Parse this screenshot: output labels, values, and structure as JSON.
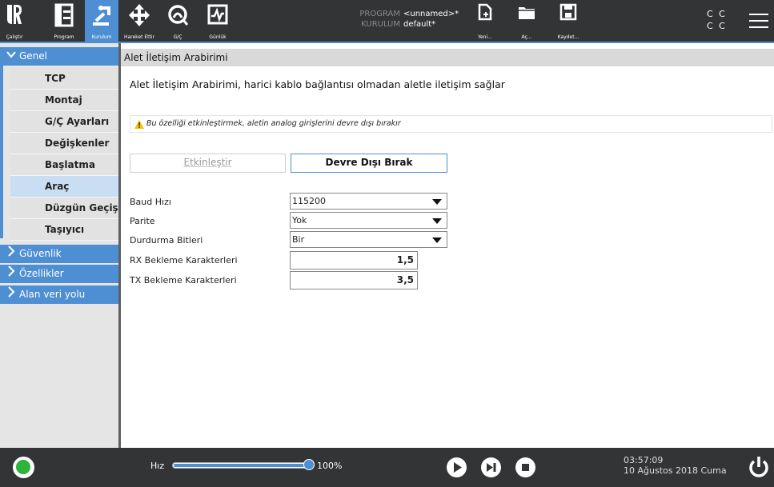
{
  "topbar": {
    "nav": [
      {
        "id": "calistir",
        "label": "Çalıştır",
        "icon": "ur-logo-icon"
      },
      {
        "id": "program",
        "label": "Program",
        "icon": "program-tree-icon"
      },
      {
        "id": "kurulum",
        "label": "Kurulum",
        "icon": "installation-robot-icon"
      },
      {
        "id": "hareket",
        "label": "Hareket Ettir",
        "icon": "move-arrows-icon"
      },
      {
        "id": "gc",
        "label": "G/Ç",
        "icon": "io-gauge-icon"
      },
      {
        "id": "gunluk",
        "label": "Günlük",
        "icon": "log-chart-icon"
      }
    ],
    "program_key": "PROGRAM",
    "program_value": "<unnamed>*",
    "installation_key": "KURULUM",
    "installation_value": "default*",
    "file_buttons": [
      {
        "id": "yeni",
        "label": "Yeni...",
        "icon": "new-file-icon"
      },
      {
        "id": "ac",
        "label": "Aç...",
        "icon": "open-folder-icon"
      },
      {
        "id": "kaydet",
        "label": "Kaydet...",
        "icon": "save-disk-icon"
      }
    ],
    "cc_line1": "C C",
    "cc_line2": "C C"
  },
  "sidebar": {
    "sections": [
      {
        "label": "Genel",
        "expanded": true
      },
      {
        "label": "Güvenlik",
        "expanded": false
      },
      {
        "label": "Özellikler",
        "expanded": false
      },
      {
        "label": "Alan veri yolu",
        "expanded": false
      }
    ],
    "items": [
      {
        "label": "TCP",
        "active": false
      },
      {
        "label": "Montaj",
        "active": false
      },
      {
        "label": "G/Ç Ayarları",
        "active": false
      },
      {
        "label": "Değişkenler",
        "active": false
      },
      {
        "label": "Başlatma",
        "active": false
      },
      {
        "label": "Araç",
        "active": true
      },
      {
        "label": "Düzgün Geçiş",
        "active": false
      },
      {
        "label": "Taşıyıcı Takibi",
        "active": false
      }
    ]
  },
  "main": {
    "header": "Alet İletişim Arabirimi",
    "description": "Alet İletişim Arabirimi, harici kablo bağlantısı olmadan aletle iletişim sağlar",
    "warning": "Bu özelliği etkinleştirmek, aletin analog girişlerini devre dışı bırakır",
    "enable_label": "Etkinleştir",
    "disable_label": "Devre Dışı Bırak",
    "fields": {
      "baud_label": "Baud Hızı",
      "baud_value": "115200",
      "parity_label": "Parite",
      "parity_value": "Yok",
      "stopbits_label": "Durdurma Bitleri",
      "stopbits_value": "Bir",
      "rx_label": "RX Bekleme Karakterleri",
      "rx_value": "1,5",
      "tx_label": "TX Bekleme Karakterleri",
      "tx_value": "3,5"
    }
  },
  "bottombar": {
    "speed_label": "Hız",
    "speed_value": "100%",
    "speed_fraction": 1.0,
    "time": "03:57:09",
    "date": "10 Ağustos 2018 Cuma"
  },
  "colors": {
    "accent": "#4e8fd3",
    "bar": "#333435",
    "status_green": "#2fb33a",
    "warning_yellow": "#f2c200"
  }
}
